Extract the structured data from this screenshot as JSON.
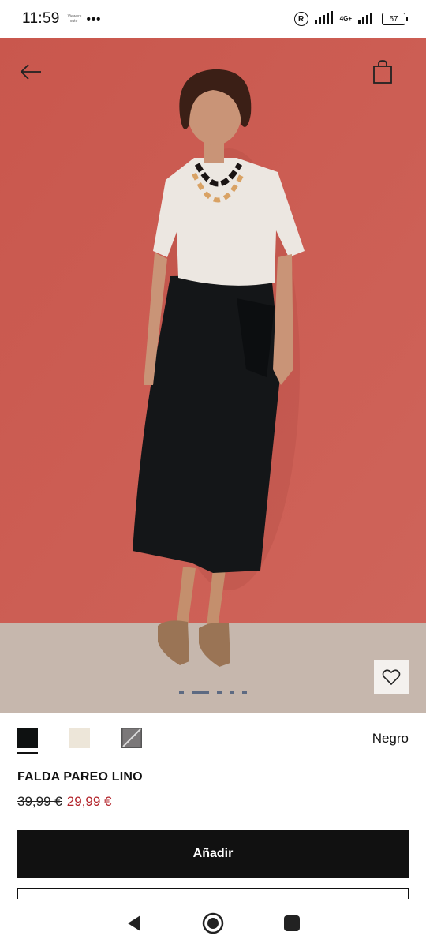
{
  "status_bar": {
    "time": "11:59",
    "mini_text": "Viewers cute",
    "dots": "•••",
    "r_badge": "R",
    "network": "4G+",
    "battery": "57"
  },
  "product": {
    "color_name": "Negro",
    "name": "FALDA PAREO LINO",
    "price_old": "39,99 €",
    "price_new": "29,99 €",
    "swatches": [
      "#0e1111",
      "#ede6d9",
      "#7b7879"
    ],
    "selected_swatch": 0
  },
  "gallery": {
    "image_count": 5,
    "active_index": 1
  },
  "actions": {
    "add_label": "Añadir"
  },
  "colors": {
    "hero_background": "#c95a50",
    "floor": "#c6b7ad",
    "price_sale": "#b3242b",
    "primary_button": "#111111"
  }
}
